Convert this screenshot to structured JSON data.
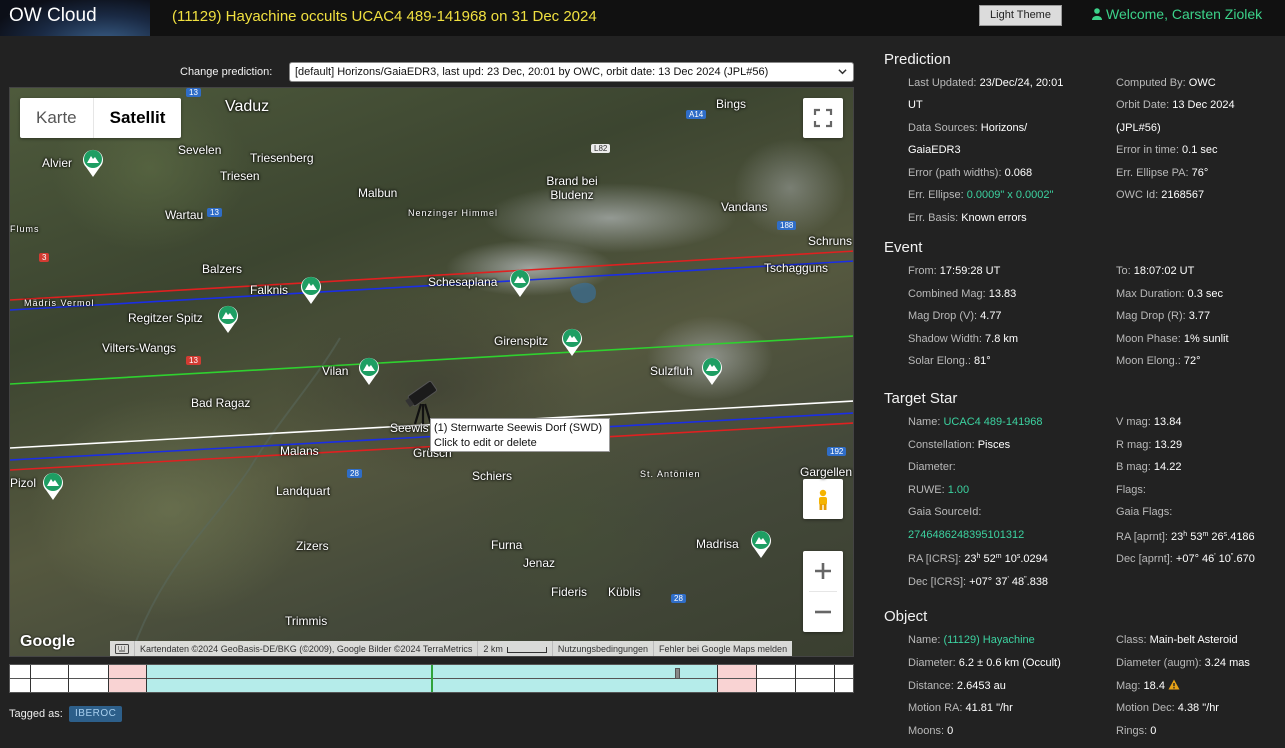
{
  "header": {
    "app_title": "OW Cloud",
    "event_title": "(11129) Hayachine occults UCAC4 489-141968 on 31 Dec 2024",
    "theme_button": "Light Theme",
    "welcome": "Welcome, Carsten Ziolek"
  },
  "prediction_select": {
    "label": "Change prediction:",
    "selected": "[default] Horizons/GaiaEDR3, last upd: 23 Dec, 20:01 by OWC, orbit date: 13 Dec 2024 (JPL#56)"
  },
  "map": {
    "type_buttons": [
      "Karte",
      "Satellit"
    ],
    "active_type": "Satellit",
    "places": [
      "Vaduz",
      "Bings",
      "Sevelen",
      "Triesenberg",
      "Triesen",
      "Malbun",
      "Brand bei Bludenz",
      "Wartau",
      "Balzers",
      "Nenzinger Himmel",
      "Vandans",
      "Schruns",
      "Tschagguns",
      "Falknis",
      "Schesaplana",
      "Regitzer Spitz",
      "Vilters-Wangs",
      "Girenspitz",
      "Sulzfluh",
      "Vilan",
      "Bad Ragaz",
      "Malans",
      "Grüsch",
      "Schiers",
      "St. Antönien",
      "Gargellen",
      "Landquart",
      "Zizers",
      "Furna",
      "Jenaz",
      "Madrisa",
      "Fideris",
      "Küblis",
      "Trimmis",
      "Pizol",
      "Flums",
      "Alvier",
      "Mädris Vermol",
      "Seewis"
    ],
    "roads": [
      "13",
      "A14",
      "L82",
      "188",
      "3",
      "13",
      "13",
      "192",
      "28",
      "28"
    ],
    "observer_popup": {
      "line1": "(1) Sternwarte Seewis Dorf (SWD)",
      "line2": "Click to edit or delete"
    },
    "attribution": {
      "google": "Google",
      "data": "Kartendaten ©2024 GeoBasis-DE/BKG (©2009), Google Bilder ©2024 TerraMetrics",
      "scale": "2 km",
      "terms": "Nutzungsbedingungen",
      "report": "Fehler bei Google Maps melden"
    }
  },
  "tagged": {
    "label": "Tagged as:",
    "tag": "IBEROC"
  },
  "prediction": {
    "title": "Prediction",
    "last_updated_label": "Last Updated:",
    "last_updated": "23/Dec/24, 20:01",
    "last_updated_tz": "UT",
    "computed_by_label": "Computed By:",
    "computed_by": "OWC",
    "data_sources_label": "Data Sources:",
    "data_sources": "Horizons/",
    "data_sources_2": "GaiaEDR3",
    "orbit_date_label": "Orbit Date:",
    "orbit_date": "13 Dec 2024",
    "orbit_date_2": "(JPL#56)",
    "error_path_label": "Error (path widths):",
    "error_path": "0.068",
    "error_time_label": "Error in time:",
    "error_time": "0.1 sec",
    "err_ellipse_label": "Err. Ellipse:",
    "err_ellipse": "0.0009\" x 0.0002\"",
    "err_ellipse_pa_label": "Err. Ellipse PA:",
    "err_ellipse_pa": "76°",
    "err_basis_label": "Err. Basis:",
    "err_basis": "Known errors",
    "owc_id_label": "OWC Id:",
    "owc_id": "2168567"
  },
  "event": {
    "title": "Event",
    "from_label": "From:",
    "from": "17:59:28 UT",
    "to_label": "To:",
    "to": "18:07:02 UT",
    "combined_mag_label": "Combined Mag:",
    "combined_mag": "13.83",
    "max_duration_label": "Max Duration:",
    "max_duration": "0.3 sec",
    "mag_drop_v_label": "Mag Drop (V):",
    "mag_drop_v": "4.77",
    "mag_drop_r_label": "Mag Drop (R):",
    "mag_drop_r": "3.77",
    "shadow_width_label": "Shadow Width:",
    "shadow_width": "7.8 km",
    "moon_phase_label": "Moon Phase:",
    "moon_phase": "1% sunlit",
    "solar_elong_label": "Solar Elong.:",
    "solar_elong": "81°",
    "moon_elong_label": "Moon Elong.:",
    "moon_elong": "72°"
  },
  "target_star": {
    "title": "Target Star",
    "name_label": "Name:",
    "name": "UCAC4 489-141968",
    "vmag_label": "V mag:",
    "vmag": "13.84",
    "constellation_label": "Constellation:",
    "constellation": "Pisces",
    "rmag_label": "R mag:",
    "rmag": "13.29",
    "diameter_label": "Diameter:",
    "bmag_label": "B mag:",
    "bmag": "14.22",
    "ruwe_label": "RUWE:",
    "ruwe": "1.00",
    "flags_label": "Flags:",
    "gaia_source_label": "Gaia SourceId:",
    "gaia_source": "2746486248395101312",
    "gaia_flags_label": "Gaia Flags:",
    "ra_icrs_label": "RA [ICRS]:",
    "ra_icrs": [
      "23",
      "h",
      " 52",
      "m",
      " 10",
      "s",
      ".0294"
    ],
    "ra_aprnt_label": "RA [aprnt]:",
    "ra_aprnt": [
      "23",
      "h",
      " 53",
      "m",
      " 26",
      "s",
      ".4186"
    ],
    "dec_icrs_label": "Dec [ICRS]:",
    "dec_icrs": [
      "+07° 37",
      "'",
      " 48",
      "\"",
      ".838"
    ],
    "dec_aprnt_label": "Dec [aprnt]:",
    "dec_aprnt": [
      "+07° 46",
      "'",
      " 10",
      "\"",
      ".670"
    ]
  },
  "object": {
    "title": "Object",
    "name_label": "Name:",
    "name": "(11129) Hayachine",
    "class_label": "Class:",
    "class": "Main-belt Asteroid",
    "diameter_label": "Diameter:",
    "diameter": "6.2 ± 0.6 km",
    "diameter_note": "(Occult)",
    "diameter_augm_label": "Diameter (augm):",
    "diameter_augm": "3.24 mas",
    "distance_label": "Distance:",
    "distance": "2.6453 au",
    "mag_label": "Mag:",
    "mag": "18.4",
    "motion_ra_label": "Motion RA:",
    "motion_ra": "41.81 \"/hr",
    "motion_dec_label": "Motion Dec:",
    "motion_dec": "4.38 \"/hr",
    "moons_label": "Moons:",
    "moons": "0",
    "rings_label": "Rings:",
    "rings": "0"
  },
  "colors": {
    "accent": "#3cd2a0",
    "title": "#f0e040",
    "path_center": "#2fd12f",
    "path_edge": "#1a2ee6",
    "path_error": "#e02020",
    "path_sigma": "#ffffff"
  }
}
